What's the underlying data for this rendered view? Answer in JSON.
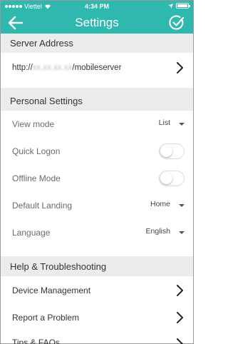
{
  "status_bar": {
    "carrier": "Viettel",
    "time": "4:34 PM"
  },
  "nav": {
    "title": "Settings",
    "back_icon": "arrow-left-icon",
    "confirm_icon": "check-circle-icon"
  },
  "server": {
    "header": "Server Address",
    "url_prefix": "http://",
    "url_blurred": "xx.xx.xx.xx",
    "url_suffix": "/mobileserver"
  },
  "personal": {
    "header": "Personal Settings",
    "view_mode_label": "View mode",
    "view_mode_value": "List",
    "quick_logon_label": "Quick Logon",
    "quick_logon_on": false,
    "offline_mode_label": "Offline Mode",
    "offline_mode_on": false,
    "default_landing_label": "Default Landing",
    "default_landing_value": "Home",
    "language_label": "Language",
    "language_value": "English"
  },
  "help": {
    "header": "Help & Troubleshooting",
    "device_management": "Device Management",
    "report_problem": "Report a Problem",
    "tips_faqs": "Tips & FAQs"
  },
  "colors": {
    "brand": "#2fb8ad",
    "section_bg": "#ececec"
  }
}
